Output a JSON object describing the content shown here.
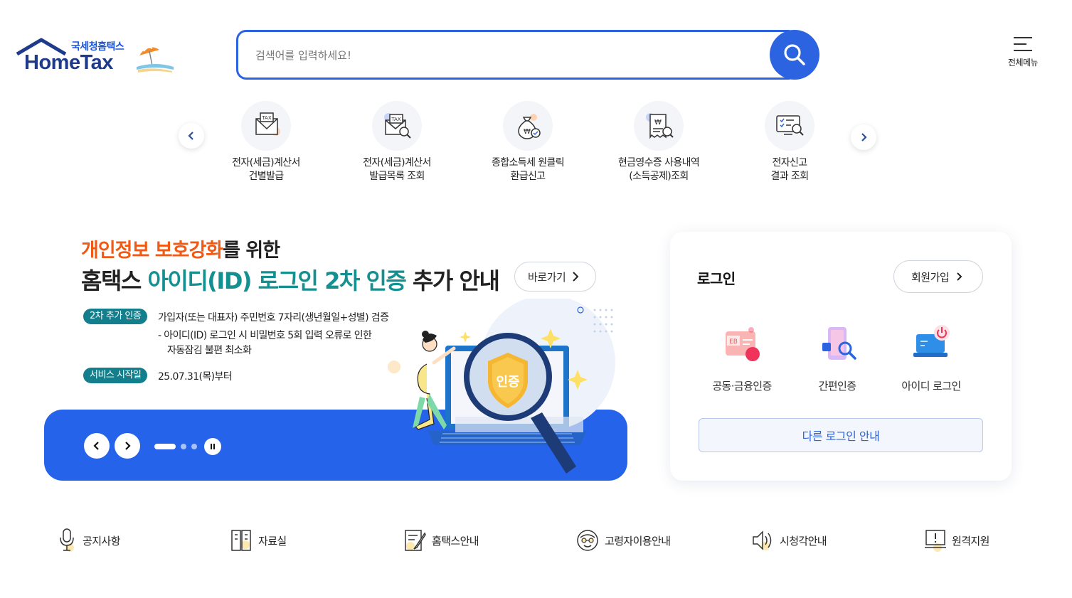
{
  "header": {
    "logo_sub": "국세청홈택스",
    "logo_main": "HomeTax",
    "search_placeholder": "검색어를 입력하세요!",
    "menu_label": "전체메뉴"
  },
  "quick_services": [
    {
      "line1": "전자(세금)계산서",
      "line2": "건별발급",
      "icon": "tax-envelope-icon"
    },
    {
      "line1": "전자(세금)계산서",
      "line2": "발급목록 조회",
      "icon": "tax-search-icon"
    },
    {
      "line1": "종합소득세 원클릭",
      "line2": "환급신고",
      "icon": "money-bag-icon"
    },
    {
      "line1": "현금영수증 사용내역",
      "line2": "(소득공제)조회",
      "icon": "receipt-icon"
    },
    {
      "line1": "전자신고",
      "line2": "결과 조회",
      "icon": "monitor-search-icon"
    }
  ],
  "banner": {
    "line1_highlight": "개인정보 보호강화",
    "line1_rest": "를 위한",
    "line2_a": "홈택스 ",
    "line2_highlight": "아이디(ID) 로그인 2차 인증",
    "line2_b": " 추가 안내",
    "goto_label": "바로가기",
    "tag1": "2차 추가 인증",
    "desc1": "가입자(또는 대표자) 주민번호 7자리(생년월일+성별) 검증",
    "desc2": "- 아이디(ID) 로그인 시 비밀번호 5회 입력 오류로 인한",
    "desc3": "자동잠김 불편 최소화",
    "tag2": "서비스 시작일",
    "start_date": "25.07.31(목)부터",
    "badge_text": "인증",
    "slide_count": 3,
    "active_slide": 1
  },
  "login": {
    "title": "로그인",
    "signup_label": "회원가입",
    "options": [
      {
        "label": "공동·금융인증",
        "icon": "certificate-card-icon"
      },
      {
        "label": "간편인증",
        "icon": "phone-auth-icon"
      },
      {
        "label": "아이디 로그인",
        "icon": "laptop-id-icon"
      }
    ],
    "other_label": "다른 로그인 안내"
  },
  "bottom_links": [
    {
      "label": "공지사항",
      "icon": "microphone-icon"
    },
    {
      "label": "자료실",
      "icon": "archive-icon"
    },
    {
      "label": "홈택스안내",
      "icon": "document-edit-icon"
    },
    {
      "label": "고령자이용안내",
      "icon": "senior-icon"
    },
    {
      "label": "시청각안내",
      "icon": "speaker-icon"
    },
    {
      "label": "원격지원",
      "icon": "remote-support-icon"
    }
  ],
  "colors": {
    "primary": "#2b63e0",
    "banner_blue": "#2563eb",
    "orange": "#f05a14",
    "teal": "#13908f",
    "tag": "#137f8c"
  }
}
